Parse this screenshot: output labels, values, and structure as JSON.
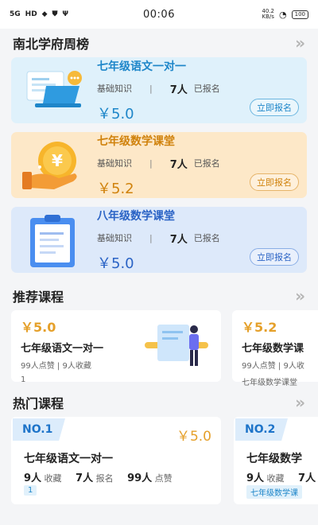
{
  "status_bar": {
    "signal": "5G",
    "hd": "HD",
    "time": "00:06",
    "speed": "40.2",
    "speed_unit": "KB/s",
    "battery": "100"
  },
  "weekly": {
    "title": "南北学府周榜",
    "more": "»",
    "cards": [
      {
        "title": "七年级语文一对一",
        "tag": "基础知识",
        "sep": "|",
        "count": "7人",
        "count_suffix": "已报名",
        "price": "￥5.0",
        "button": "立即报名"
      },
      {
        "title": "七年级数学课堂",
        "tag": "基础知识",
        "sep": "|",
        "count": "7人",
        "count_suffix": "已报名",
        "price": "￥5.2",
        "button": "立即报名"
      },
      {
        "title": "八年级数学课堂",
        "tag": "基础知识",
        "sep": "|",
        "count": "7人",
        "count_suffix": "已报名",
        "price": "￥5.0",
        "button": "立即报名"
      }
    ]
  },
  "recommend": {
    "title": "推荐课程",
    "more": "»",
    "cards": [
      {
        "price": "￥5.0",
        "title": "七年级语文一对一",
        "meta": "99人点赞 | 9人收藏",
        "extra": "1"
      },
      {
        "price": "￥5.2",
        "title": "七年级数学课",
        "meta": "99人点赞 | 9人收",
        "extra": "七年级数学课堂"
      }
    ]
  },
  "hot": {
    "title": "热门课程",
    "more": "»",
    "cards": [
      {
        "rank": "NO.1",
        "price": "￥5.0",
        "title": "七年级语文一对一",
        "collect_num": "9人",
        "collect_label": "收藏",
        "signup_num": "7人",
        "signup_label": "报名",
        "like_num": "99人",
        "like_label": "点赞",
        "tag": "1"
      },
      {
        "rank": "NO.2",
        "price": "",
        "title": "七年级数学",
        "collect_num": "9人",
        "collect_label": "收藏",
        "signup_num": "7人",
        "signup_label": "",
        "like_num": "",
        "like_label": "",
        "tag": "七年级数学课"
      }
    ]
  },
  "colors": {
    "blue": "#1e86c9",
    "orange": "#d0820c",
    "gold": "#e5a02a"
  },
  "icons": {
    "weekly_1": "laptop-illustration",
    "weekly_2": "coin-hand-illustration",
    "weekly_3": "clipboard-illustration",
    "recommend_1": "person-board-illustration"
  }
}
